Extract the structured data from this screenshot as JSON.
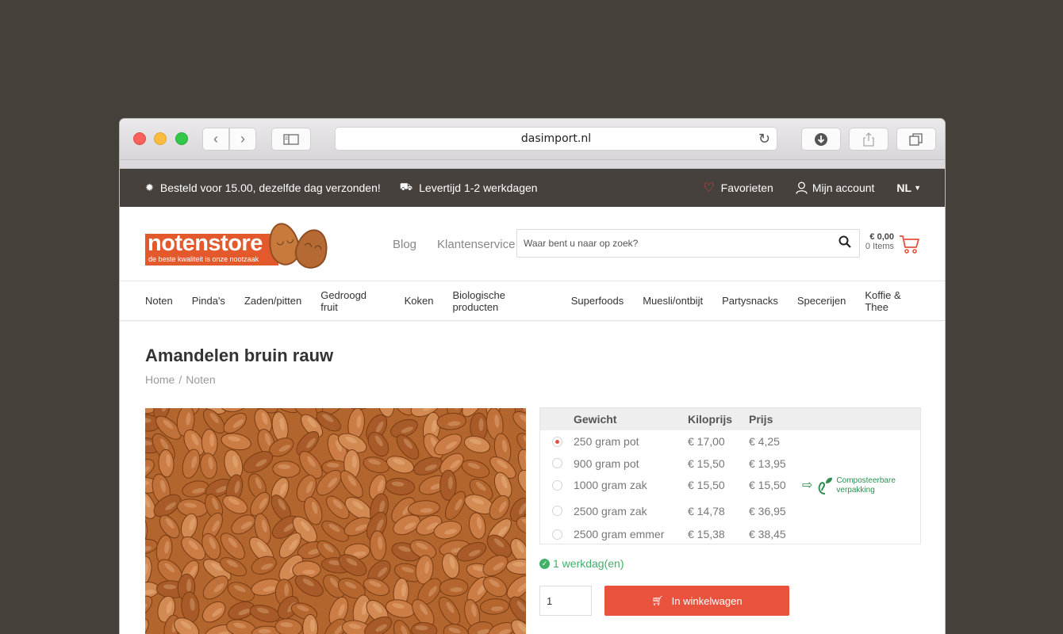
{
  "browser": {
    "url": "dasimport.nl"
  },
  "topbar": {
    "shipping_msg": "Besteld voor 15.00, dezelfde dag verzonden!",
    "delivery_msg": "Levertijd 1-2 werkdagen",
    "favorites": "Favorieten",
    "account": "Mijn account",
    "language": "NL"
  },
  "logo": {
    "name": "notenstore",
    "tagline": "de beste kwaliteit is onze nootzaak"
  },
  "header": {
    "links": [
      "Blog",
      "Klantenservice"
    ],
    "search_placeholder": "Waar bent u naar op zoek?",
    "cart_price": "€ 0,00",
    "cart_items": "0 Items"
  },
  "nav": [
    "Noten",
    "Pinda's",
    "Zaden/pitten",
    "Gedroogd fruit",
    "Koken",
    "Biologische producten",
    "Superfoods",
    "Muesli/ontbijt",
    "Partysnacks",
    "Specerijen",
    "Koffie & Thee"
  ],
  "product": {
    "title": "Amandelen bruin rauw",
    "breadcrumb": [
      "Home",
      "Noten"
    ],
    "breadcrumb_sep": "/",
    "table_headers": [
      "Gewicht",
      "Kiloprijs",
      "Prijs"
    ],
    "variants": [
      {
        "weight": "250 gram pot",
        "kilo": "€ 17,00",
        "price": "€ 4,25",
        "selected": true
      },
      {
        "weight": "900 gram pot",
        "kilo": "€ 15,50",
        "price": "€ 13,95",
        "selected": false
      },
      {
        "weight": "1000 gram zak",
        "kilo": "€ 15,50",
        "price": "€ 15,50",
        "selected": false
      },
      {
        "weight": "2500 gram zak",
        "kilo": "€ 14,78",
        "price": "€ 36,95",
        "selected": false
      },
      {
        "weight": "2500 gram emmer",
        "kilo": "€ 15,38",
        "price": "€ 38,45",
        "selected": false
      }
    ],
    "compost_label_1": "Composteerbare",
    "compost_label_2": "verpakking",
    "delivery": "1 werkdag(en)",
    "quantity": "1",
    "add_to_cart": "In winkelwagen"
  },
  "colors": {
    "accent": "#e9523d",
    "topbar": "#47413d",
    "success": "#43b06a"
  }
}
